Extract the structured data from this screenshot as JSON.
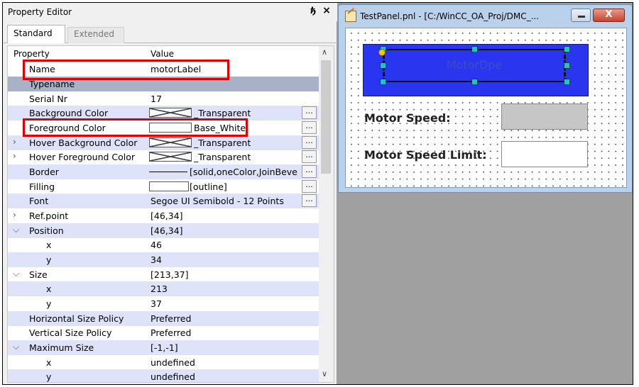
{
  "property_editor": {
    "title": "Property Editor",
    "float_glyph": "ђ",
    "close_glyph": "×",
    "tabs": [
      {
        "label": "Standard",
        "active": true
      },
      {
        "label": "Extended",
        "active": false
      }
    ],
    "columns": {
      "property": "Property",
      "value": "Value"
    },
    "rows": [
      {
        "name": "Name",
        "value": "motorLabel"
      },
      {
        "name": "Typename",
        "value": ""
      },
      {
        "name": "Serial Nr",
        "value": "17"
      },
      {
        "name": "Background Color",
        "value": "_Transparent"
      },
      {
        "name": "Foreground Color",
        "value": "Base_White"
      },
      {
        "name": "Hover Background Color",
        "value": "_Transparent"
      },
      {
        "name": "Hover Foreground Color",
        "value": "_Transparent"
      },
      {
        "name": "Border",
        "value": "[solid,oneColor,JoinBeve"
      },
      {
        "name": "Filling",
        "value": "[outline]"
      },
      {
        "name": "Font",
        "value": "Segoe UI Semibold - 12 Points"
      },
      {
        "name": "Ref.point",
        "value": "[46,34]"
      },
      {
        "name": "Position",
        "value": "[46,34]"
      },
      {
        "name": "x",
        "value": "46"
      },
      {
        "name": "y",
        "value": "34"
      },
      {
        "name": "Size",
        "value": "[213,37]"
      },
      {
        "name": "x",
        "value": "213"
      },
      {
        "name": "y",
        "value": "37"
      },
      {
        "name": "Horizontal Size Policy",
        "value": "Preferred"
      },
      {
        "name": "Vertical Size Policy",
        "value": "Preferred"
      },
      {
        "name": "Maximum Size",
        "value": "[-1,-1]"
      },
      {
        "name": "x",
        "value": "undefined"
      },
      {
        "name": "y",
        "value": "undefined"
      }
    ],
    "ellipsis": "...",
    "icons": {
      "expand": "chevron-right-icon",
      "collapse": "chevron-down-icon",
      "scroll_up": "chevron-up-icon",
      "scroll_down": "chevron-down-icon"
    },
    "colors": {
      "row_alt": "#dfe3f9",
      "row_selected": "#a9b1c9",
      "highlight": "#e00000"
    }
  },
  "panel_window": {
    "title": "TestPanel.pnl - [C:/WinCC_OA_Proj/DMC_...",
    "minimize_glyph": "",
    "close_glyph": "X",
    "label_text": "MotorDpe",
    "motor_speed_label": "Motor Speed:",
    "motor_speed_limit_label": "Motor Speed Limit:",
    "colors": {
      "label_bg": "#2a35f0",
      "speed_box": "#c6c6c6",
      "handle": "#26c0c8"
    }
  }
}
